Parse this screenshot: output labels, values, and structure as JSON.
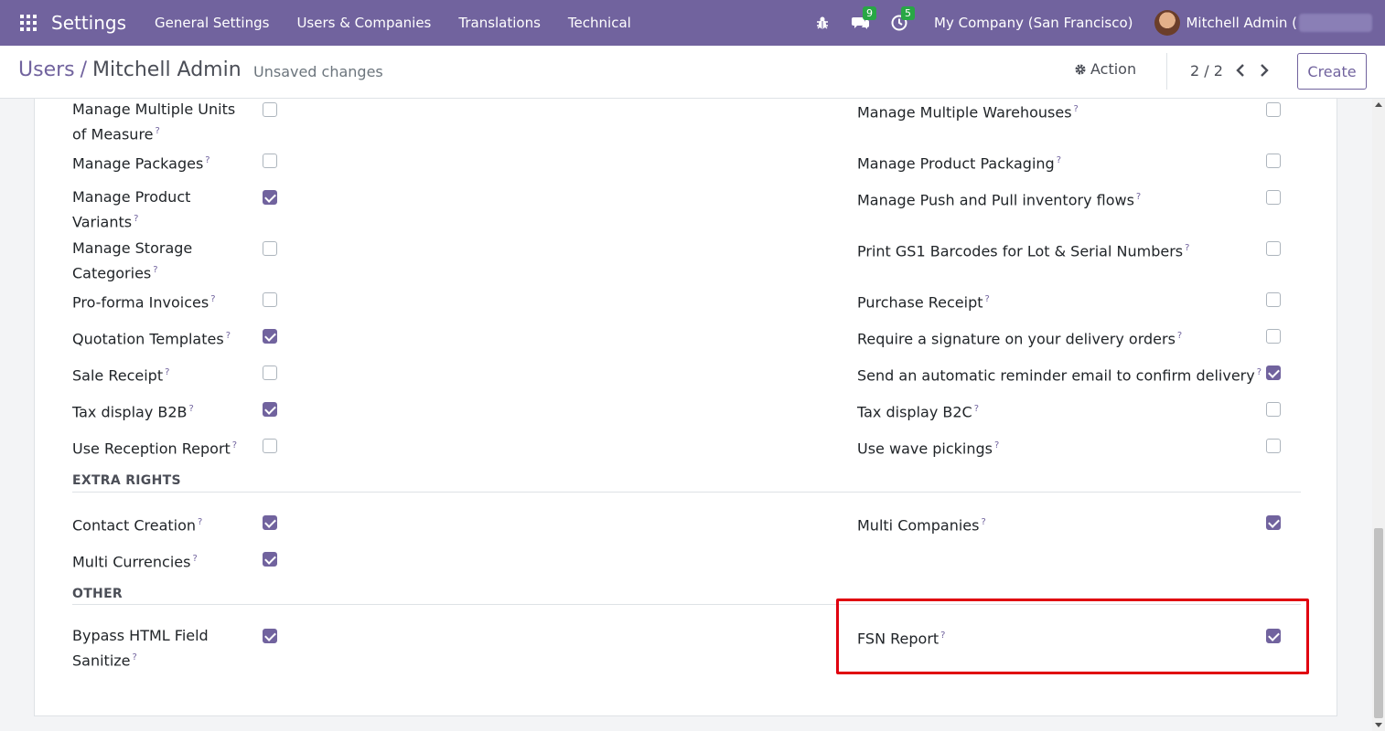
{
  "topbar": {
    "app_name": "Settings",
    "menu": [
      "General Settings",
      "Users & Companies",
      "Translations",
      "Technical"
    ],
    "messages_count": "9",
    "activities_count": "5",
    "company": "My Company (San Francisco)",
    "user": "Mitchell Admin ("
  },
  "control_panel": {
    "breadcrumb_parent": "Users",
    "breadcrumb_separator": "/",
    "breadcrumb_current": "Mitchell Admin",
    "status": "Unsaved changes",
    "action_label": "Action",
    "pager": "2 / 2",
    "create_label": "Create"
  },
  "left_rows": [
    {
      "label": "Manage Multiple Units of Measure",
      "checked": false
    },
    {
      "label": "Manage Packages",
      "checked": false
    },
    {
      "label": "Manage Product Variants",
      "checked": true
    },
    {
      "label": "Manage Storage Categories",
      "checked": false
    },
    {
      "label": "Pro-forma Invoices",
      "checked": false
    },
    {
      "label": "Quotation Templates",
      "checked": true
    },
    {
      "label": "Sale Receipt",
      "checked": false
    },
    {
      "label": "Tax display B2B",
      "checked": true
    },
    {
      "label": "Use Reception Report",
      "checked": false
    }
  ],
  "right_rows": [
    {
      "label": "Manage Multiple Warehouses",
      "checked": false
    },
    {
      "label": "Manage Product Packaging",
      "checked": false
    },
    {
      "label": "Manage Push and Pull inventory flows",
      "checked": false
    },
    {
      "label": "Print GS1 Barcodes for Lot & Serial Numbers",
      "checked": false
    },
    {
      "label": "Purchase Receipt",
      "checked": false
    },
    {
      "label": "Require a signature on your delivery orders",
      "checked": false
    },
    {
      "label": "Send an automatic reminder email to confirm delivery",
      "checked": true
    },
    {
      "label": "Tax display B2C",
      "checked": false
    },
    {
      "label": "Use wave pickings",
      "checked": false
    }
  ],
  "extra_rights": {
    "title": "EXTRA RIGHTS",
    "left": [
      {
        "label": "Contact Creation",
        "checked": true
      },
      {
        "label": "Multi Currencies",
        "checked": true
      }
    ],
    "right": [
      {
        "label": "Multi Companies",
        "checked": true
      }
    ]
  },
  "other": {
    "title": "OTHER",
    "left": [
      {
        "label": "Bypass HTML Field Sanitize",
        "checked": true
      }
    ],
    "right": [
      {
        "label": "FSN Report",
        "checked": true
      }
    ]
  },
  "help_marker": "?",
  "colors": {
    "navbar": "#71639e",
    "checkbox_checked": "#71639e",
    "highlight": "#e0000f",
    "badge": "#28a745"
  }
}
